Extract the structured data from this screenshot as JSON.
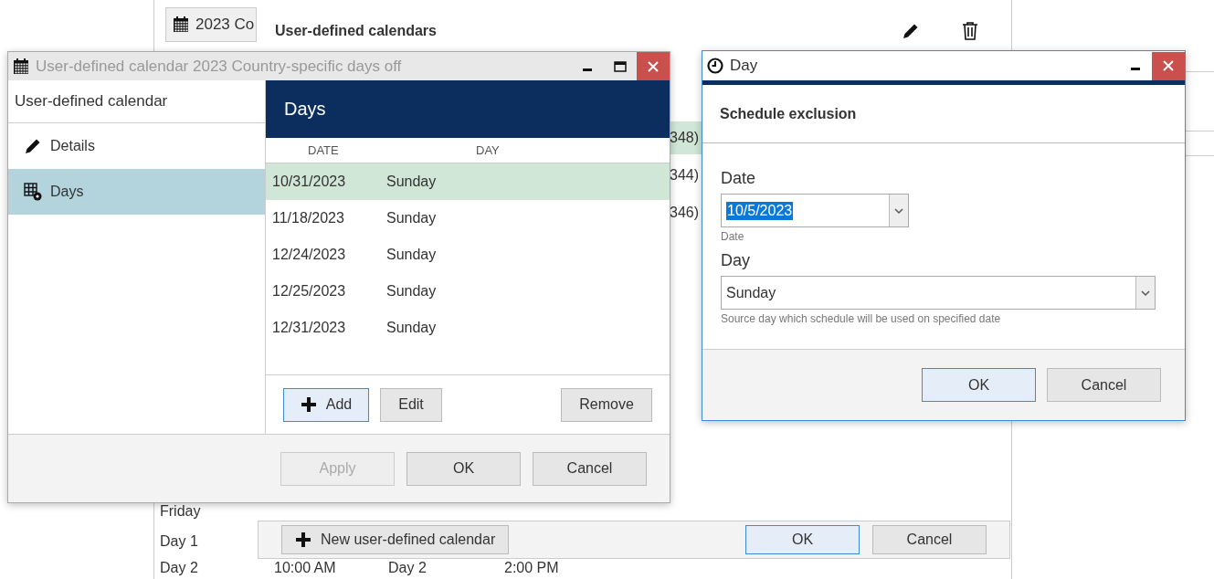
{
  "background_window": {
    "calendar_button": "2023 Co",
    "heading": "User-defined calendars",
    "list_cells": [
      {
        "text": "348)",
        "selected": true
      },
      {
        "text": "344)",
        "selected": false
      },
      {
        "text": "346)",
        "selected": false
      }
    ],
    "schedule_rows": [
      {
        "cells": [
          "Friday"
        ]
      },
      {
        "cells": [
          "Day 1"
        ]
      },
      {
        "cells": [
          "Day 2",
          "10:00 AM",
          "Day 2",
          "2:00 PM"
        ]
      }
    ],
    "new_button": "New user-defined calendar",
    "buttons": [
      {
        "label": "OK",
        "focused": true
      },
      {
        "label": "Cancel",
        "focused": false
      }
    ]
  },
  "calendar_window": {
    "title": "User-defined calendar 2023 Country-specific days off",
    "nav_header": "User-defined calendar",
    "nav_items": [
      {
        "label": "Details",
        "kind": "pencil",
        "selected": false
      },
      {
        "label": "Days",
        "kind": "grid",
        "selected": true
      }
    ],
    "panel_title": "Days",
    "columns": [
      "DATE",
      "DAY"
    ],
    "rows": [
      {
        "date": "10/31/2023",
        "day": "Sunday",
        "selected": true
      },
      {
        "date": "11/18/2023",
        "day": "Sunday",
        "selected": false
      },
      {
        "date": "12/24/2023",
        "day": "Sunday",
        "selected": false
      },
      {
        "date": "12/25/2023",
        "day": "Sunday",
        "selected": false
      },
      {
        "date": "12/31/2023",
        "day": "Sunday",
        "selected": false
      }
    ],
    "list_buttons": [
      {
        "label": "Add",
        "kind": "add",
        "focused": true
      },
      {
        "label": "Edit",
        "kind": "plain",
        "focused": false
      },
      {
        "label": "Remove",
        "kind": "plain",
        "focused": false
      }
    ],
    "footer_buttons": [
      {
        "label": "Apply",
        "disabled": true
      },
      {
        "label": "OK",
        "disabled": false
      },
      {
        "label": "Cancel",
        "disabled": false
      }
    ]
  },
  "day_dialog": {
    "title": "Day",
    "heading": "Schedule exclusion",
    "date_label": "Date",
    "date_value": "10/5/2023",
    "date_hint": "Date",
    "day_label": "Day",
    "day_value": "Sunday",
    "day_hint": "Source day which schedule will be used on specified date",
    "buttons": [
      {
        "label": "OK",
        "focused": true
      },
      {
        "label": "Cancel",
        "focused": false
      }
    ]
  }
}
